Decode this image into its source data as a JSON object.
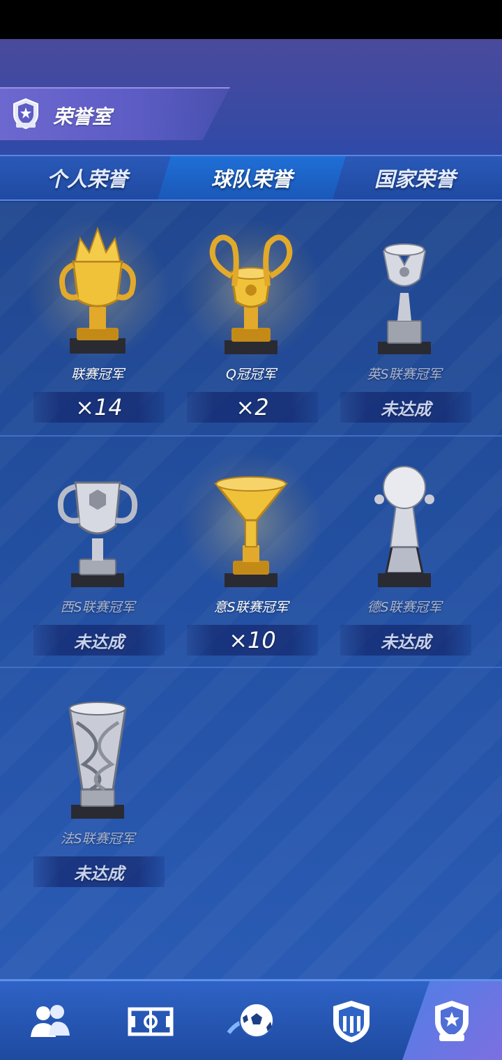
{
  "page": {
    "title": "荣誉室"
  },
  "tabs": [
    {
      "label": "个人荣誉",
      "active": false
    },
    {
      "label": "球队荣誉",
      "active": true
    },
    {
      "label": "国家荣誉",
      "active": false
    }
  ],
  "trophies": [
    {
      "name": "联赛冠军",
      "count": "×14",
      "achieved": true,
      "icon": "gold-crown-trophy-icon"
    },
    {
      "name": "Q冠冠军",
      "count": "×2",
      "achieved": true,
      "icon": "gold-big-ears-trophy-icon"
    },
    {
      "name": "英S联赛冠军",
      "count": "未达成",
      "achieved": false,
      "icon": "silver-winged-trophy-icon"
    },
    {
      "name": "西S联赛冠军",
      "count": "未达成",
      "achieved": false,
      "icon": "silver-handled-cup-icon"
    },
    {
      "name": "意S联赛冠军",
      "count": "×10",
      "achieved": true,
      "icon": "gold-funnel-trophy-icon"
    },
    {
      "name": "德S联赛冠军",
      "count": "未达成",
      "achieved": false,
      "icon": "silver-ball-trophy-icon"
    },
    {
      "name": "法S联赛冠军",
      "count": "未达成",
      "achieved": false,
      "icon": "silver-twisted-trophy-icon"
    }
  ],
  "bottom_nav": [
    {
      "icon": "team-players-icon",
      "active": false
    },
    {
      "icon": "pitch-field-icon",
      "active": false
    },
    {
      "icon": "soccer-ball-icon",
      "active": false
    },
    {
      "icon": "club-badge-icon",
      "active": false
    },
    {
      "icon": "trophy-badge-icon",
      "active": true
    }
  ],
  "colors": {
    "gold": "#f0c23a",
    "silver": "#c9ccd6",
    "active_tab": "#1f6fd6",
    "background": "#2350a2"
  }
}
